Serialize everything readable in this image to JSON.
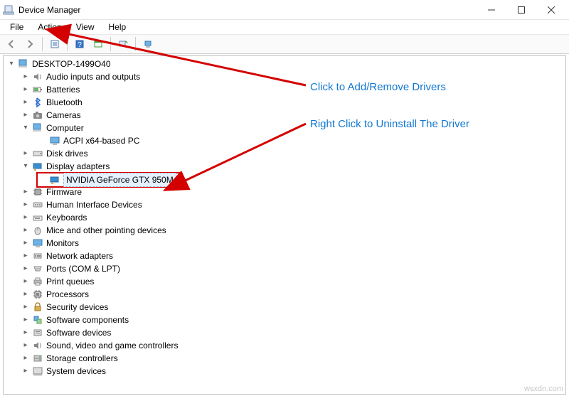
{
  "window": {
    "title": "Device Manager"
  },
  "menubar": {
    "file": "File",
    "action": "Action",
    "view": "View",
    "help": "Help"
  },
  "tree": {
    "root": "DESKTOP-1499O40",
    "audio": "Audio inputs and outputs",
    "batteries": "Batteries",
    "bluetooth": "Bluetooth",
    "cameras": "Cameras",
    "computer": "Computer",
    "acpi": "ACPI x64-based PC",
    "disk": "Disk drives",
    "display": "Display adapters",
    "nvidia": "NVIDIA GeForce GTX 950M",
    "firmware": "Firmware",
    "hid": "Human Interface Devices",
    "keyboards": "Keyboards",
    "mice": "Mice and other pointing devices",
    "monitors": "Monitors",
    "network": "Network adapters",
    "ports": "Ports (COM & LPT)",
    "printq": "Print queues",
    "processors": "Processors",
    "security": "Security devices",
    "softcomp": "Software components",
    "softdev": "Software devices",
    "sound": "Sound, video and game controllers",
    "storage": "Storage controllers",
    "system": "System devices"
  },
  "annotations": {
    "top": "Click to Add/Remove Drivers",
    "mid": "Right Click to Uninstall The Driver"
  },
  "watermark": "wsxdn.com"
}
